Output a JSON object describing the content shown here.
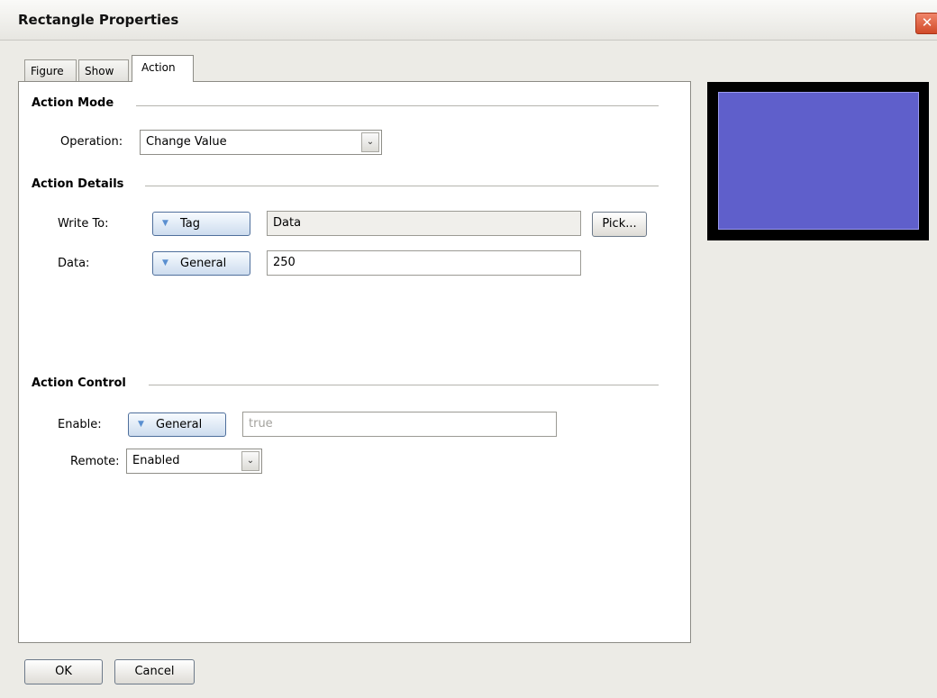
{
  "window": {
    "title": "Rectangle Properties",
    "close_glyph": "✕"
  },
  "tabs": [
    {
      "label": "Figure",
      "active": false
    },
    {
      "label": "Show",
      "active": false
    },
    {
      "label": "Action",
      "active": true
    }
  ],
  "action_mode": {
    "heading": "Action Mode",
    "operation_label": "Operation:",
    "operation_value": "Change Value"
  },
  "action_details": {
    "heading": "Action Details",
    "write_to_label": "Write To:",
    "write_to_type": "Tag",
    "write_to_value": "Data",
    "pick_label": "Pick...",
    "data_label": "Data:",
    "data_type": "General",
    "data_value": "250"
  },
  "action_control": {
    "heading": "Action Control",
    "enable_label": "Enable:",
    "enable_type": "General",
    "enable_value": "true",
    "remote_label": "Remote:",
    "remote_value": "Enabled"
  },
  "footer": {
    "ok_label": "OK",
    "cancel_label": "Cancel"
  },
  "icons": {
    "dropdown": "chevron-down-icon",
    "type_menu": "triangle-down-icon",
    "close": "close-icon"
  },
  "glyphs": {
    "chevron": "⌄",
    "triangle": "▼"
  },
  "colors": {
    "preview_fill": "#5f5fcb",
    "preview_border": "#000000",
    "accent_button": "#cddcee",
    "close_button": "#d14a28"
  }
}
